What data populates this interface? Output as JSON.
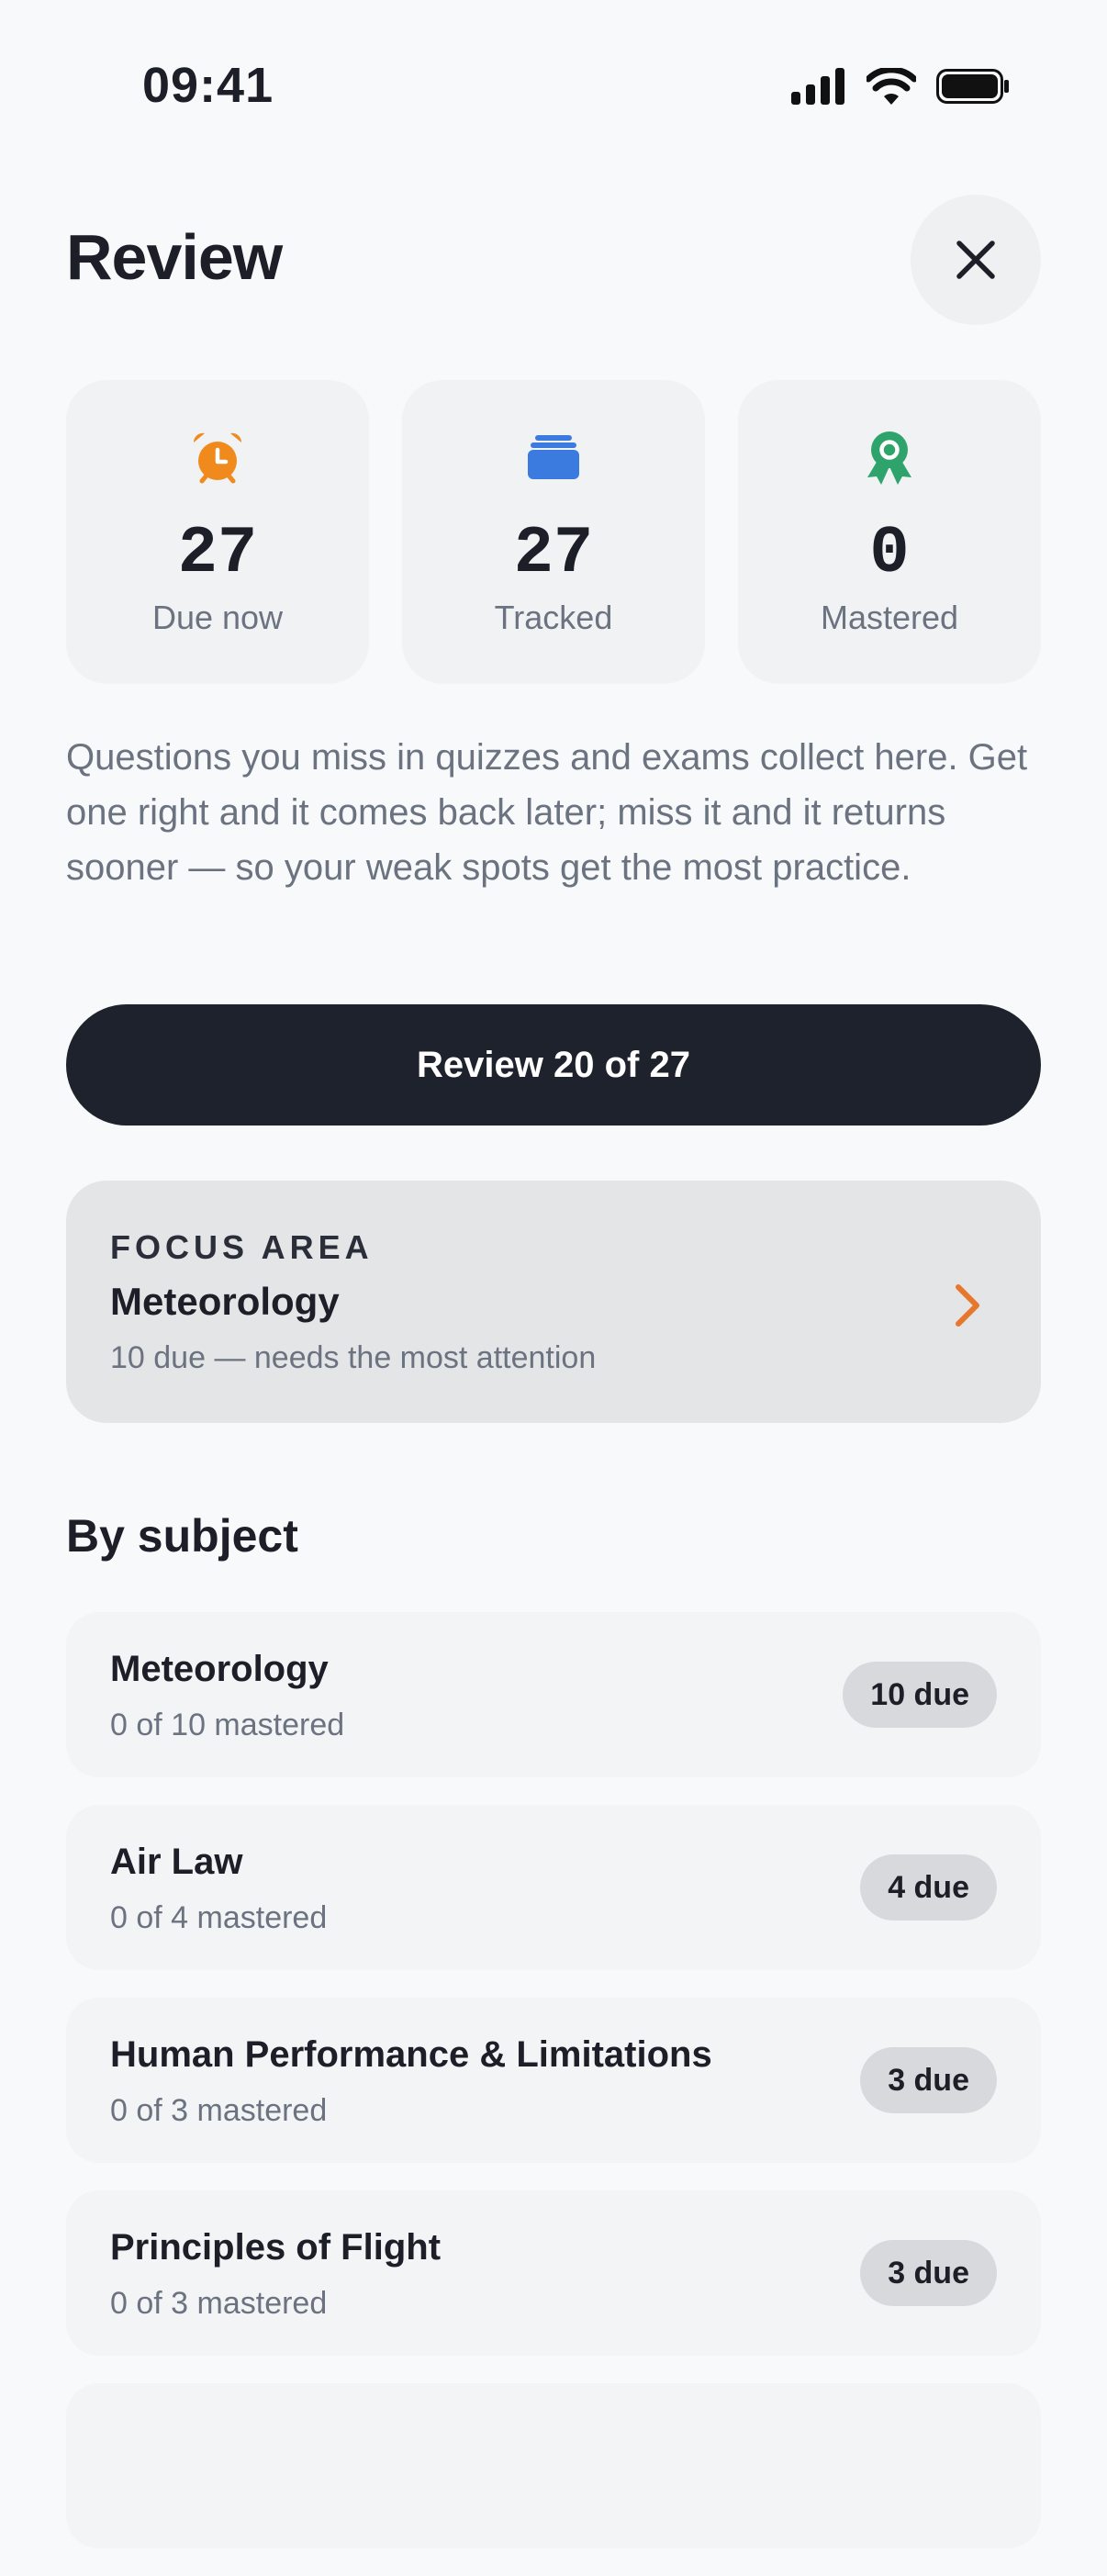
{
  "status_bar": {
    "time": "09:41"
  },
  "header": {
    "title": "Review"
  },
  "stats": [
    {
      "icon": "alarm-clock-icon",
      "value": "27",
      "label": "Due now",
      "color": "#f08a1c"
    },
    {
      "icon": "card-stack-icon",
      "value": "27",
      "label": "Tracked",
      "color": "#3b7be0"
    },
    {
      "icon": "award-badge-icon",
      "value": "0",
      "label": "Mastered",
      "color": "#2ea36b"
    }
  ],
  "description": "Questions you miss in quizzes and exams collect here. Get one right and it comes back later; miss it and it returns sooner — so your weak spots get the most practice.",
  "review_button": {
    "label": "Review 20 of 27"
  },
  "focus_area": {
    "eyebrow": "FOCUS AREA",
    "title": "Meteorology",
    "subtitle": "10 due — needs the most attention",
    "accent": "#e8772e"
  },
  "by_subject": {
    "title": "By subject",
    "items": [
      {
        "name": "Meteorology",
        "progress": "0 of 10 mastered",
        "due": "10 due"
      },
      {
        "name": "Air Law",
        "progress": "0 of 4 mastered",
        "due": "4 due"
      },
      {
        "name": "Human Performance & Limitations",
        "progress": "0 of 3 mastered",
        "due": "3 due"
      },
      {
        "name": "Principles of Flight",
        "progress": "0 of 3 mastered",
        "due": "3 due"
      }
    ]
  }
}
